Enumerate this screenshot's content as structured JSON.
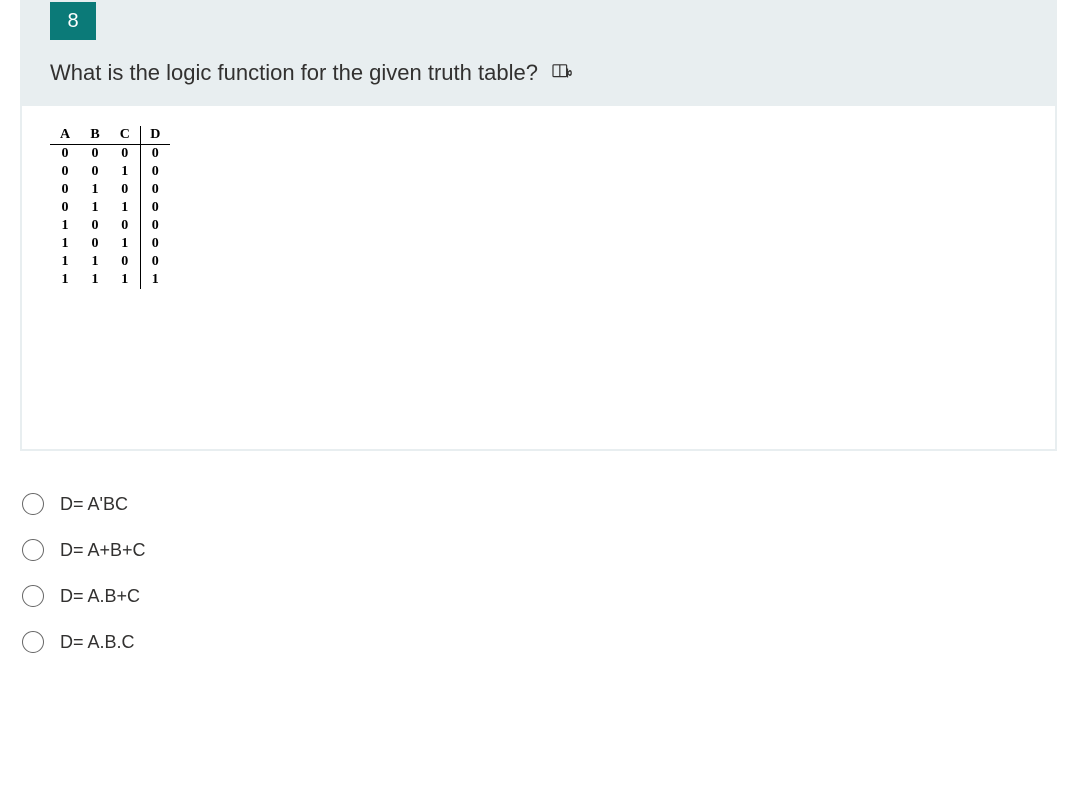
{
  "question": {
    "number": "8",
    "text": "What is the logic function for the given truth table?"
  },
  "chart_data": {
    "type": "table",
    "columns": [
      "A",
      "B",
      "C",
      "D"
    ],
    "rows": [
      [
        "0",
        "0",
        "0",
        "0"
      ],
      [
        "0",
        "0",
        "1",
        "0"
      ],
      [
        "0",
        "1",
        "0",
        "0"
      ],
      [
        "0",
        "1",
        "1",
        "0"
      ],
      [
        "1",
        "0",
        "0",
        "0"
      ],
      [
        "1",
        "0",
        "1",
        "0"
      ],
      [
        "1",
        "1",
        "0",
        "0"
      ],
      [
        "1",
        "1",
        "1",
        "1"
      ]
    ]
  },
  "options": [
    {
      "label": "D= A'BC"
    },
    {
      "label": "D= A+B+C"
    },
    {
      "label": "D= A.B+C"
    },
    {
      "label": "D= A.B.C"
    }
  ]
}
